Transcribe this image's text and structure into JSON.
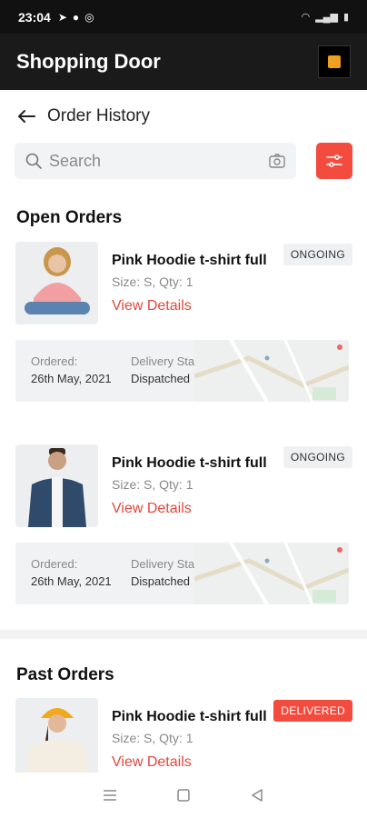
{
  "status_bar": {
    "time": "23:04"
  },
  "app": {
    "title": "Shopping Door"
  },
  "page": {
    "title": "Order History"
  },
  "search": {
    "placeholder": "Search"
  },
  "sections": {
    "open_title": "Open Orders",
    "past_title": "Past Orders"
  },
  "open_orders": [
    {
      "name": "Pink Hoodie t-shirt full",
      "meta": "Size: S, Qty: 1",
      "link": "View Details",
      "status": "ONGOING",
      "ordered_label": "Ordered:",
      "ordered_value": "26th May, 2021",
      "delivery_label": "Delivery Status:",
      "delivery_value": "Dispatched"
    },
    {
      "name": "Pink Hoodie t-shirt full",
      "meta": "Size: S, Qty: 1",
      "link": "View Details",
      "status": "ONGOING",
      "ordered_label": "Ordered:",
      "ordered_value": "26th May, 2021",
      "delivery_label": "Delivery Status:",
      "delivery_value": "Dispatched"
    }
  ],
  "past_orders": [
    {
      "name": "Pink Hoodie t-shirt full",
      "meta": "Size: S, Qty: 1",
      "link": "View Details",
      "status": "DELIVERED"
    }
  ],
  "colors": {
    "accent": "#f44b3f",
    "app_bar": "#1a1a1a",
    "link": "#e0483c"
  }
}
